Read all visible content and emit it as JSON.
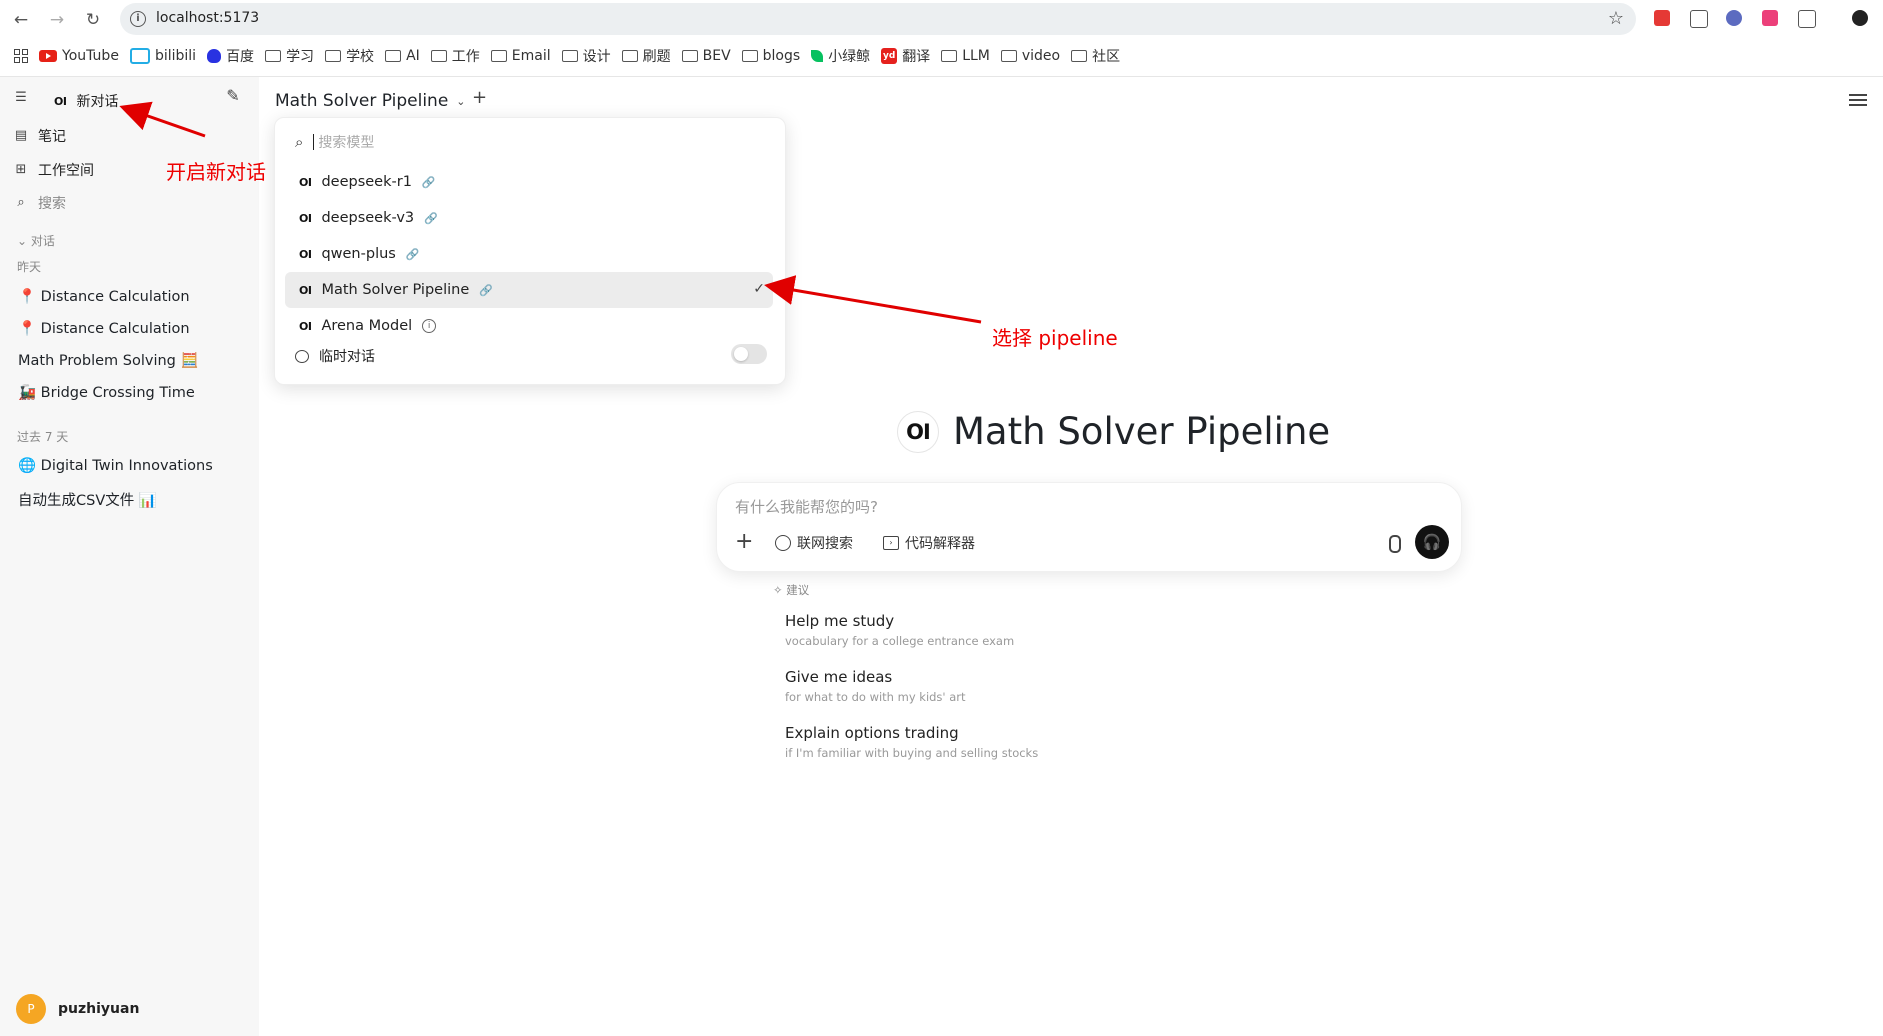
{
  "browser": {
    "url": "localhost:5173",
    "bookmarks": [
      "YouTube",
      "bilibili",
      "百度",
      "学习",
      "学校",
      "AI",
      "工作",
      "Email",
      "设计",
      "刷题",
      "BEV",
      "blogs",
      "小绿鲸",
      "翻译",
      "LLM",
      "video",
      "社区"
    ]
  },
  "sidebar": {
    "new_chat": "新对话",
    "nav": [
      {
        "label": "笔记",
        "icon": "note-icon"
      },
      {
        "label": "工作空间",
        "icon": "grid-icon"
      },
      {
        "label": "搜索",
        "icon": "search-icon"
      }
    ],
    "section": "对话",
    "group_yesterday": "昨天",
    "yesterday_chats": [
      "📍 Distance Calculation",
      "📍 Distance Calculation",
      "Math Problem Solving 🧮",
      "🚂 Bridge Crossing Time"
    ],
    "group_week": "过去 7 天",
    "week_chats": [
      "🌐 Digital Twin Innovations",
      "自动生成CSV文件 📊"
    ],
    "user": {
      "initial": "P",
      "name": "puzhiyuan"
    }
  },
  "header": {
    "model": "Math Solver Pipeline"
  },
  "dropdown": {
    "search_placeholder": "搜索模型",
    "models": [
      {
        "name": "deepseek-r1",
        "selected": false
      },
      {
        "name": "deepseek-v3",
        "selected": false
      },
      {
        "name": "qwen-plus",
        "selected": false
      },
      {
        "name": "Math Solver Pipeline",
        "selected": true
      },
      {
        "name": "Arena Model",
        "selected": false
      }
    ],
    "temp_chat": "临时对话",
    "temp_chat_enabled": false
  },
  "hero": {
    "logo": "OI",
    "title": "Math Solver Pipeline"
  },
  "composer": {
    "placeholder": "有什么我能帮您的吗?",
    "web_search": "联网搜索",
    "code_interpreter": "代码解释器"
  },
  "suggestions": {
    "label": "建议",
    "items": [
      {
        "title": "Help me study",
        "sub": "vocabulary for a college entrance exam"
      },
      {
        "title": "Give me ideas",
        "sub": "for what to do with my kids' art"
      },
      {
        "title": "Explain options trading",
        "sub": "if I'm familiar with buying and selling stocks"
      }
    ]
  },
  "annotations": {
    "new_chat": "开启新对话",
    "select_pipeline": "选择 pipeline",
    "color": "#e00000"
  }
}
